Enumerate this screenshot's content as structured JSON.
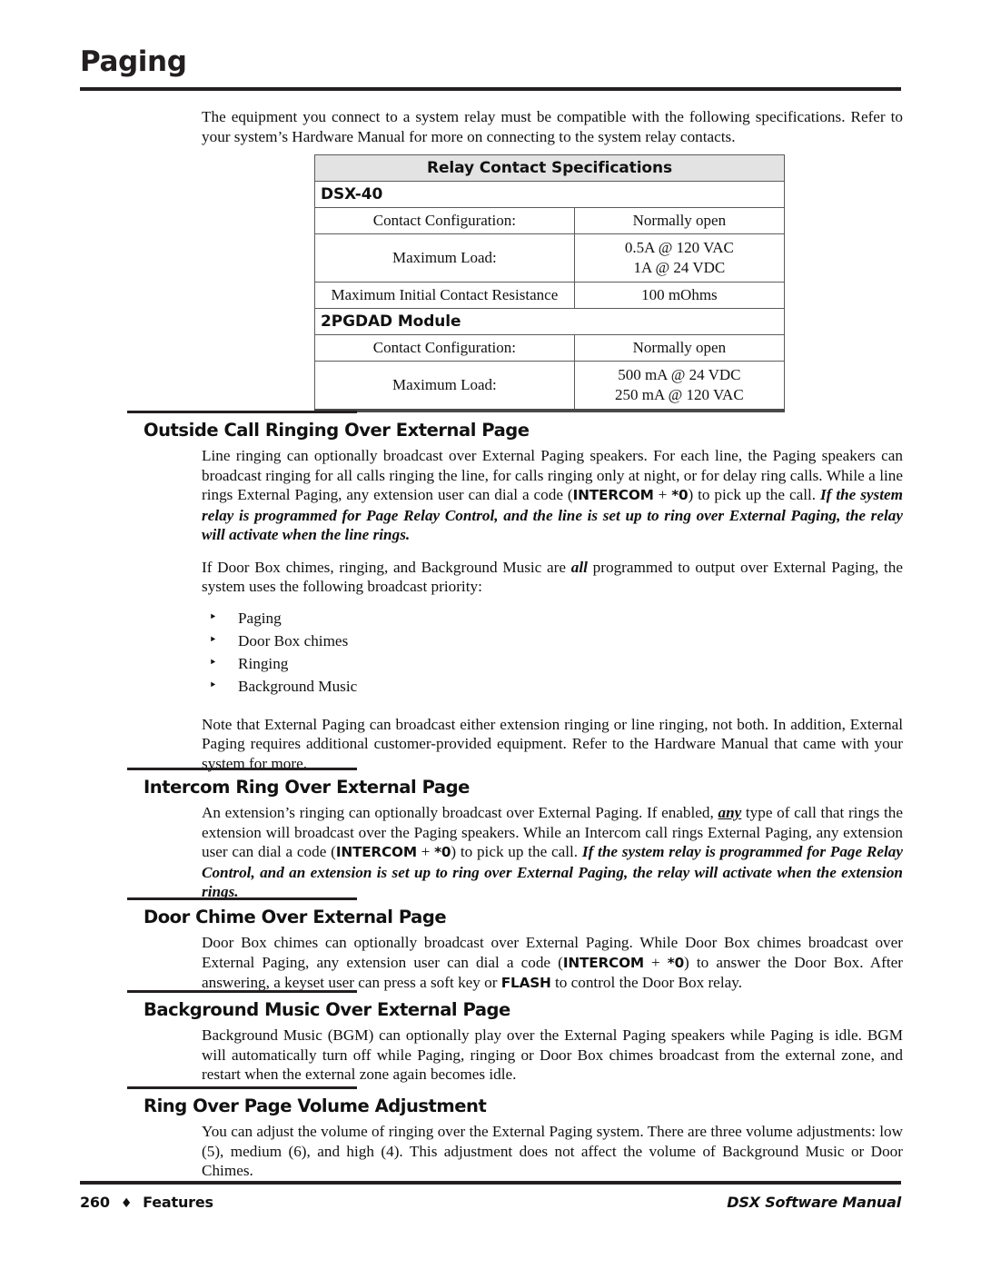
{
  "page": {
    "title": "Paging"
  },
  "intro": {
    "paragraph": "The equipment you connect to a system relay must be compatible with the following specifications. Refer to your system’s Hardware Manual for more on connecting to the system relay contacts."
  },
  "spec_table": {
    "caption": "Relay Contact Specifications",
    "groups": [
      {
        "name": "DSX-40",
        "rows": [
          {
            "label": "Contact Configuration:",
            "values": [
              "Normally open"
            ]
          },
          {
            "label": "Maximum Load:",
            "values": [
              "0.5A @ 120 VAC",
              "1A @ 24 VDC"
            ]
          },
          {
            "label": "Maximum Initial Contact Resistance",
            "values": [
              "100 mOhms"
            ]
          }
        ]
      },
      {
        "name": "2PGDAD Module",
        "rows": [
          {
            "label": "Contact Configuration:",
            "values": [
              "Normally open"
            ]
          },
          {
            "label": "Maximum Load:",
            "values": [
              "500 mA @ 24 VDC",
              "250 mA @ 120 VAC"
            ]
          }
        ]
      }
    ]
  },
  "sections": [
    {
      "heading": "Outside Call Ringing Over External Page",
      "p1_a": "Line ringing can optionally broadcast over External Paging speakers. For each line, the Paging speakers can broadcast ringing for all calls ringing the line, for calls ringing only at night, or for delay ring calls. While a line rings External Paging, any extension user can dial a code (",
      "p1_code": "INTERCOM",
      "p1_plus": " + ",
      "p1_star": "*0",
      "p1_b": ") to pick up the call. ",
      "p1_em": "If the system relay is programmed for Page Relay Control, and the line is set up to ring over External Paging, the relay will activate when the line rings.",
      "p2_a": "If Door Box chimes, ringing, and Background Music are ",
      "p2_em": "all",
      "p2_b": " programmed to output over External Paging, the system uses the following broadcast priority:",
      "bullets": [
        "Paging",
        "Door Box chimes",
        "Ringing",
        "Background Music"
      ],
      "p3": "Note that External Paging can broadcast either extension ringing or line ringing, not both. In addition, External Paging requires additional customer-provided equipment. Refer to the Hardware Manual that came with your system for more."
    },
    {
      "heading": "Intercom Ring Over External Page",
      "p1_a": "An extension’s ringing can optionally broadcast over External Paging. If enabled, ",
      "p1_underline": "any",
      "p1_b": " type of call that rings the extension will broadcast over the Paging speakers. While an Intercom call rings External Paging, any extension user can dial a code (",
      "p1_code": "INTERCOM",
      "p1_plus": " + ",
      "p1_star": "*0",
      "p1_c": ") to pick up the call. ",
      "p1_em": "If the system relay is programmed for Page Relay Control, and an extension is set up to ring over External Paging, the relay will activate when the extension rings."
    },
    {
      "heading": "Door Chime Over External Page",
      "p1_a": "Door Box chimes can optionally broadcast over External Paging. While Door Box chimes broadcast over External Paging, any extension user can dial a code (",
      "p1_code": "INTERCOM",
      "p1_plus": " + ",
      "p1_star": "*0",
      "p1_b": ") to answer the Door Box. After answering, a keyset user can press a soft key or ",
      "p1_flash": "FLASH",
      "p1_c": " to control the Door Box relay."
    },
    {
      "heading": "Background Music Over External Page",
      "p1": "Background Music (BGM) can optionally play over the External Paging speakers while Paging is idle. BGM will automatically turn off while Paging, ringing or Door Box chimes broadcast from the external zone, and restart when the external zone again becomes idle."
    },
    {
      "heading": "Ring Over Page Volume Adjustment",
      "p1": "You can adjust the volume of ringing over the External Paging system. There are three volume adjustments: low (5), medium (6), and high (4). This adjustment does not affect the volume of Background Music or Door Chimes."
    }
  ],
  "footer": {
    "page_number": "260",
    "separator": "♦",
    "left_label": "Features",
    "right_label": "DSX Software Manual"
  },
  "icons": {
    "bullet": "‣"
  }
}
